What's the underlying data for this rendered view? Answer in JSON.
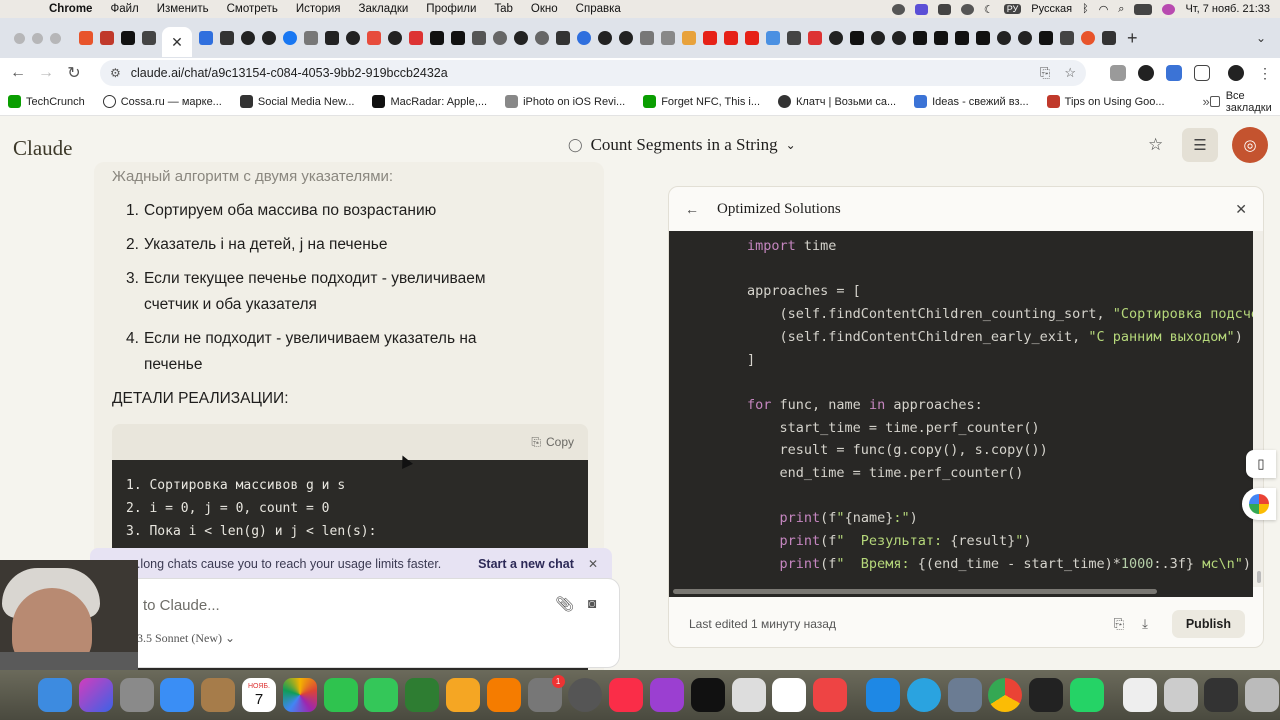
{
  "menubar": {
    "app": "Chrome",
    "items": [
      "Файл",
      "Изменить",
      "Смотреть",
      "История",
      "Закладки",
      "Профили",
      "Tab",
      "Окно",
      "Справка"
    ],
    "input_source": "РУ",
    "language": "Русская",
    "clock": "Чт, 7 нояб.  21:33"
  },
  "browser": {
    "url": "claude.ai/chat/a9c13154-c084-4053-9bb2-919bccb2432a",
    "bookmarks": [
      "TechCrunch",
      "Cossa.ru — марке...",
      "Social Media New...",
      "MacRadar: Apple,...",
      "iPhoto on iOS Revi...",
      "Forget NFC, This i...",
      "Клатч | Возьми са...",
      "Ideas - свежий вз...",
      "Tips on Using Goo..."
    ],
    "all_bookmarks": "Все закладки",
    "colors": {
      "tabstrip": "#dfe3ea",
      "toolbar": "#ffffff"
    }
  },
  "claude": {
    "logo": "Claude",
    "chat_title": "Count Segments in a String",
    "brand_color": "#c4532f"
  },
  "chat": {
    "prev_line": "Жадный алгоритм с двумя указателями:",
    "steps": [
      {
        "num": "1.",
        "text": "Сортируем оба массива по возрастанию"
      },
      {
        "num": "2.",
        "text": "Указатель i на детей, j на печенье"
      },
      {
        "num": "3.",
        "text": "Если текущее печенье подходит - увеличиваем счетчик и оба указателя"
      },
      {
        "num": "4.",
        "text": "Если не подходит - увеличиваем указатель на печенье"
      }
    ],
    "impl_heading": "ДЕТАЛИ РЕАЛИЗАЦИИ:",
    "copy_label": "Copy",
    "code_lines": [
      "1. Сортировка массивов g и s",
      "2. i = 0, j = 0, count = 0",
      "3. Пока i < len(g) и j < len(s):"
    ]
  },
  "notice": {
    "text": "...long chats cause you to reach your usage limits faster.",
    "action": "Start a new chat"
  },
  "composer": {
    "placeholder": "to Claude...",
    "model": "3.5 Sonnet (New)"
  },
  "artifact": {
    "title": "Optimized Solutions",
    "last_edited": "Last edited 1 минуту назад",
    "publish": "Publish"
  },
  "dock": {
    "calendar_month": "НОЯБ.",
    "calendar_day": "7",
    "badge": "1"
  }
}
